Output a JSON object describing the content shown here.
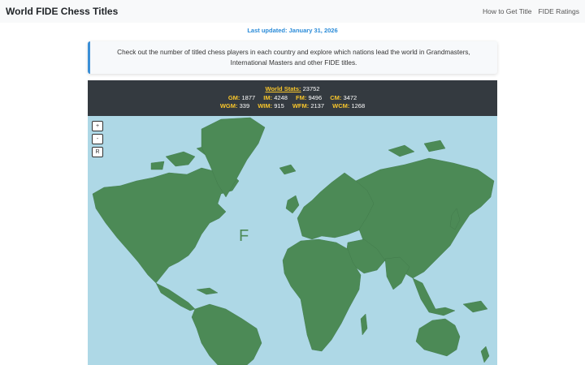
{
  "header": {
    "title": "World FIDE Chess Titles",
    "nav": [
      "How to Get Title",
      "FIDE Ratings"
    ]
  },
  "updated": {
    "label": "Last updated:",
    "date": "January 31, 2026"
  },
  "intro": "Check out the number of titled chess players in each country and explore which nations lead the world in Grandmasters, International Masters and other FIDE titles.",
  "stats": {
    "world_label": "World Stats:",
    "world_total": "23752",
    "row1": [
      {
        "k": "GM:",
        "v": "1877"
      },
      {
        "k": "IM:",
        "v": "4248"
      },
      {
        "k": "FM:",
        "v": "9496"
      },
      {
        "k": "CM:",
        "v": "3472"
      }
    ],
    "row2": [
      {
        "k": "WGM:",
        "v": "339"
      },
      {
        "k": "WIM:",
        "v": "915"
      },
      {
        "k": "WFM:",
        "v": "2137"
      },
      {
        "k": "WCM:",
        "v": "1268"
      }
    ]
  },
  "map": {
    "controls": {
      "zoom_in": "+",
      "zoom_out": "-",
      "reset": "R"
    },
    "overlay_letter": "F",
    "colors": {
      "ocean": "#aed8e6",
      "land": "#4c8a56"
    }
  }
}
